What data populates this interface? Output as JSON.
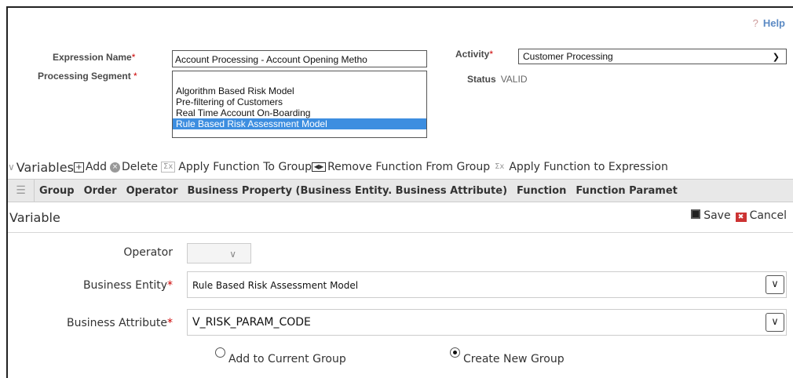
{
  "header": {
    "help_label": "Help",
    "help_icon": "?",
    "expression_name_label": "Expression Name",
    "expression_name_value": "Account Processing - Account Opening Metho",
    "activity_label": "Activity",
    "activity_value": "Customer Processing",
    "processing_segment_label": "Processing Segment",
    "processing_segment_options": [
      "Algorithm Based Risk Model",
      "Pre-filtering of Customers",
      "Real Time Account On-Boarding",
      "Rule Based Risk Assessment Model"
    ],
    "status_label": "Status",
    "status_value": "VALID",
    "required_mark": "*"
  },
  "toolbar": {
    "title": "Variables",
    "add_label": "Add",
    "delete_label": "Delete",
    "apply_group_label": "Apply Function To Group",
    "remove_group_label": "Remove Function From Group",
    "apply_expression_label": "Apply Function to Expression"
  },
  "grid": {
    "columns": [
      "Group",
      "Order",
      "Operator",
      "Business Property (Business Entity. Business Attribute)",
      "Function",
      "Function Paramet"
    ]
  },
  "variable": {
    "title": "Variable",
    "save_label": "Save",
    "cancel_label": "Cancel",
    "operator_label": "Operator",
    "operator_value": "",
    "business_entity_label": "Business Entity",
    "business_entity_value": "Rule Based Risk Assessment Model",
    "business_attribute_label": "Business Attribute",
    "business_attribute_value": "V_RISK_PARAM_CODE",
    "add_current_group_label": "Add to Current Group",
    "create_new_group_label": "Create New Group",
    "selected_option": "Create New Group"
  },
  "colors": {
    "selection": "#3d8ee0",
    "required": "#cc0000",
    "help": "#5b8ac4"
  }
}
